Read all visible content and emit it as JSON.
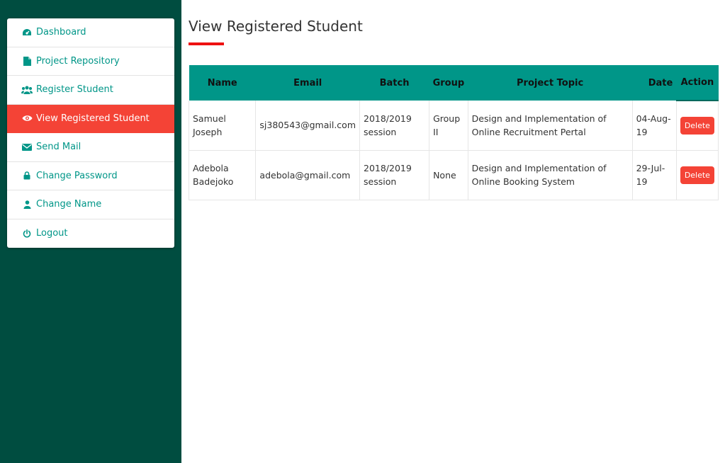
{
  "sidebar": {
    "items": [
      {
        "label": "Dashboard",
        "icon": "dashboard-icon"
      },
      {
        "label": "Project Repository",
        "icon": "file-icon"
      },
      {
        "label": "Register Student",
        "icon": "users-icon"
      },
      {
        "label": "View Registered Student",
        "icon": "eye-icon",
        "active": true
      },
      {
        "label": "Send Mail",
        "icon": "envelope-icon"
      },
      {
        "label": "Change Password",
        "icon": "lock-icon"
      },
      {
        "label": "Change Name",
        "icon": "user-icon"
      },
      {
        "label": "Logout",
        "icon": "power-icon"
      }
    ]
  },
  "main": {
    "title": "View Registered Student",
    "table": {
      "headers": [
        "Name",
        "Email",
        "Batch",
        "Group",
        "Project Topic",
        "Date",
        "Action"
      ],
      "rows": [
        {
          "name": "Samuel Joseph",
          "email": "sj380543@gmail.com",
          "batch": "2018/2019 session",
          "group": "Group II",
          "topic": "Design and Implementation of Online Recruitment Pertal",
          "date": "04-Aug-19",
          "action": "Delete"
        },
        {
          "name": "Adebola Badejoko",
          "email": "adebola@gmail.com",
          "batch": "2018/2019 session",
          "group": "None",
          "topic": "Design and Implementation of Online Booking System",
          "date": "29-Jul-19",
          "action": "Delete"
        }
      ]
    }
  },
  "colors": {
    "sidebar_bg": "#004d40",
    "accent": "#009688",
    "active": "#f44336",
    "title_underline": "#ee1111"
  }
}
